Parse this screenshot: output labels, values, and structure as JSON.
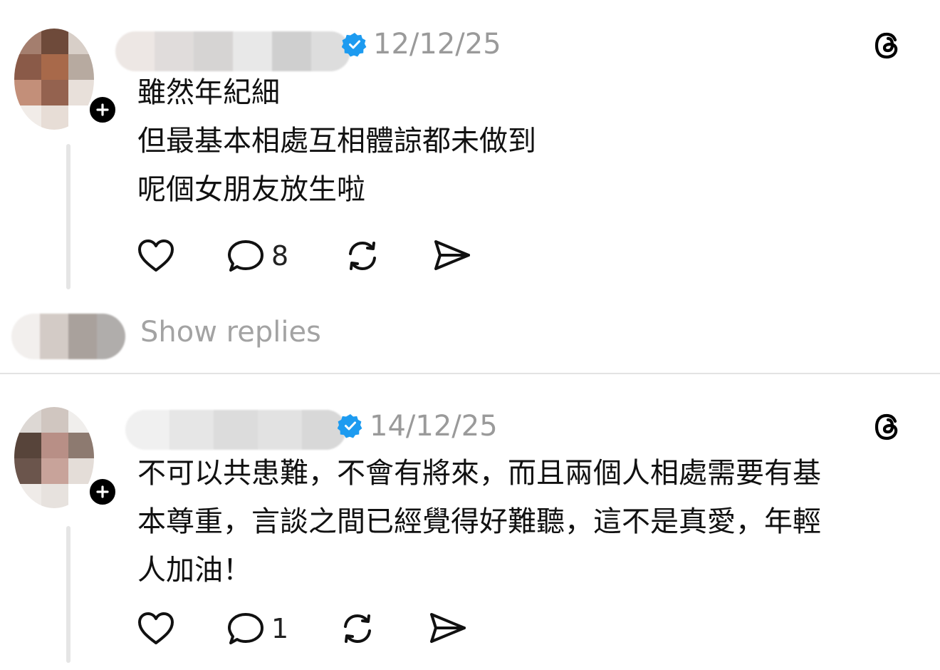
{
  "posts": [
    {
      "date": "12/12/25",
      "lines": [
        "雖然年紀細",
        "但最基本相處互相體諒都未做到",
        "呢個女朋友放生啦"
      ],
      "reply_count": "8"
    },
    {
      "date": "14/12/25",
      "lines": [
        "不可以共患難，不會有將來，而且兩個人相處需要有基",
        "本尊重，言談之間已經覺得好難聽，這不是真愛，年輕",
        "人加油！"
      ],
      "reply_count": "1"
    }
  ],
  "show_replies_label": "Show replies",
  "icons": {
    "like": "heart-icon",
    "reply": "speech-bubble-icon",
    "repost": "repost-icon",
    "share": "send-icon",
    "brand": "threads-logo-icon",
    "verified": "verified-badge-icon",
    "follow": "plus-icon"
  },
  "colors": {
    "verified": "#1d9bf0",
    "muted_text": "#9a9a9a",
    "thread_line": "#e5e5e5"
  }
}
